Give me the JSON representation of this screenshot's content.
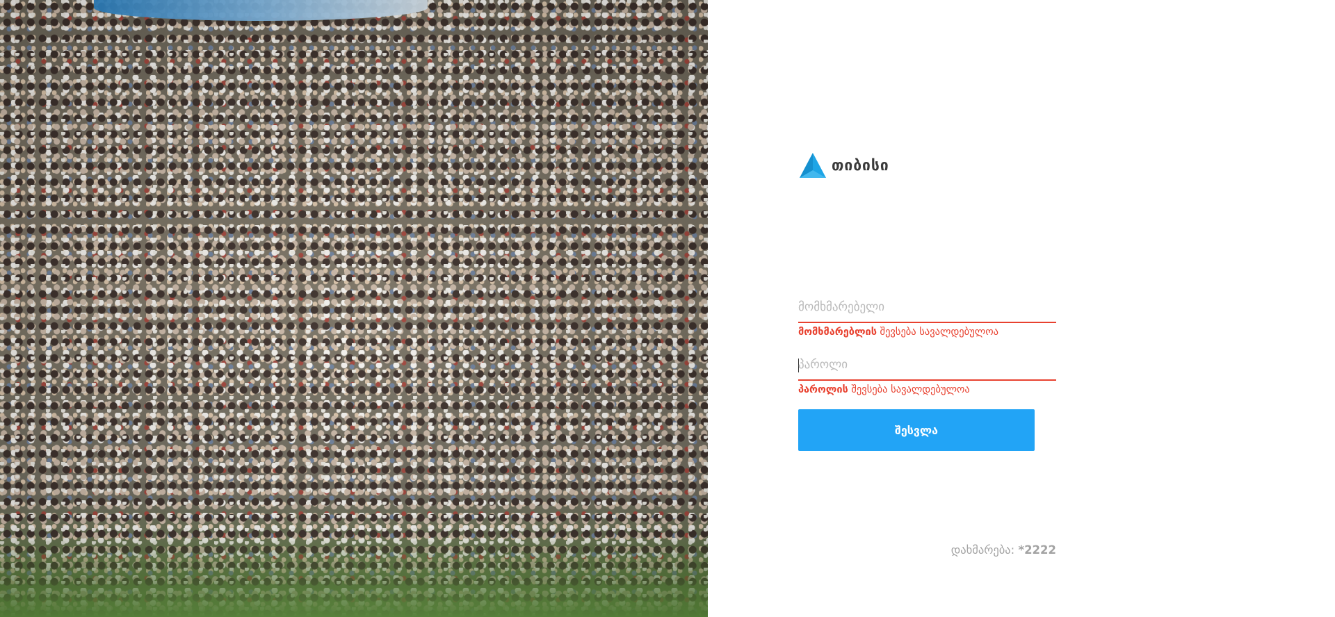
{
  "brand": {
    "name": "თიბისი",
    "logo_color": "#1ea5e6"
  },
  "hero": {
    "image": "crowd-photo"
  },
  "form": {
    "username": {
      "placeholder": "მომხმარებელი",
      "value": "",
      "error_bold": "მომხმარებლის",
      "error_rest": " შევსება სავალდებულოა"
    },
    "password": {
      "placeholder": "პაროლი",
      "value": "",
      "error_bold": "პაროლის",
      "error_rest": " შევსება სავალდებულოა"
    },
    "submit_label": "შესვლა"
  },
  "help": {
    "label": "დახმარება: ",
    "number": "*2222"
  },
  "colors": {
    "accent": "#22a4f6",
    "error": "#e8412f",
    "muted": "#a3a3a3"
  }
}
